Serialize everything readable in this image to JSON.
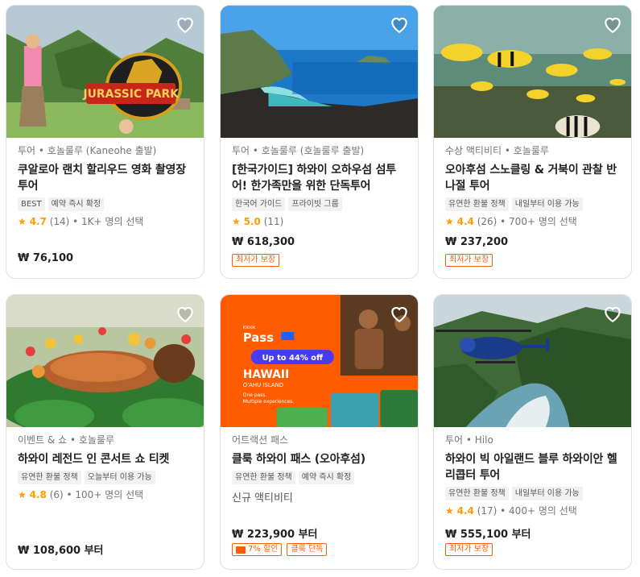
{
  "cards": [
    {
      "category": "투어 • 호놀룰루 (Kaneohe 출발)",
      "title": "쿠알로아 랜치 할리우드 영화 촬영장 투어",
      "tags": [
        "BEST",
        "예약 즉시 확정"
      ],
      "rating": {
        "star": "★",
        "score": "4.7",
        "reviews": "(14)",
        "extra": "• 1K+ 명의 선택"
      },
      "price": "₩ 76,100",
      "badges": [],
      "image_text": "JURASSIC PARK"
    },
    {
      "category": "투어 • 호놀룰루 (호놀룰루 출발)",
      "title": "[한국가이드] 하와이 오하우섬 섬투어! 한가족만을 위한 단독투어",
      "tags": [
        "한국어 가이드",
        "프라이빗 그룹"
      ],
      "rating": {
        "star": "★",
        "score": "5.0",
        "reviews": "(11)",
        "extra": ""
      },
      "price": "₩ 618,300",
      "badges": [
        "최저가 보장"
      ]
    },
    {
      "category": "수상 액티비티 • 호놀룰루",
      "title": "오아후섬 스노클링 & 거북이 관찰 반나절 투어",
      "tags": [
        "유연한 환불 정책",
        "내일부터 이용 가능"
      ],
      "rating": {
        "star": "★",
        "score": "4.4",
        "reviews": "(26)",
        "extra": "• 700+ 명의 선택"
      },
      "price": "₩ 237,200",
      "badges": [
        "최저가 보장"
      ]
    },
    {
      "category": "이벤트 & 쇼 • 호놀룰루",
      "title": "하와이 레전드 인 콘서트 쇼 티켓",
      "tags": [
        "유연한 환불 정책",
        "오늘부터 이용 가능"
      ],
      "rating": {
        "star": "★",
        "score": "4.8",
        "reviews": "(6)",
        "extra": "• 100+ 명의 선택"
      },
      "price": "₩ 108,600 부터",
      "badges": []
    },
    {
      "category": "어트랙션 패스",
      "title": "클룩 하와이 패스 (오아후섬)",
      "tags": [
        "유연한 환불 정책",
        "예약 즉시 확정"
      ],
      "rating": null,
      "extra_text": "신규 액티비티",
      "price": "₩ 223,900 부터",
      "badges": [
        "7% 할인",
        "클룩 단독"
      ],
      "image_text": {
        "brand": "klook",
        "pass": "Pass",
        "offer": "Up to 44% off",
        "place1": "HAWAII",
        "place2": "O'AHU ISLAND",
        "sub1": "One pass.",
        "sub2": "Multiple experiences."
      }
    },
    {
      "category": "투어 • Hilo",
      "title": "하와이 빅 아일랜드 블루 하와이안 헬리콥터 투어",
      "tags": [
        "유연한 환불 정책",
        "내일부터 이용 가능"
      ],
      "rating": {
        "star": "★",
        "score": "4.4",
        "reviews": "(17)",
        "extra": "• 400+ 명의 선택"
      },
      "price": "₩ 555,100 부터",
      "badges": [
        "최저가 보장"
      ]
    }
  ]
}
